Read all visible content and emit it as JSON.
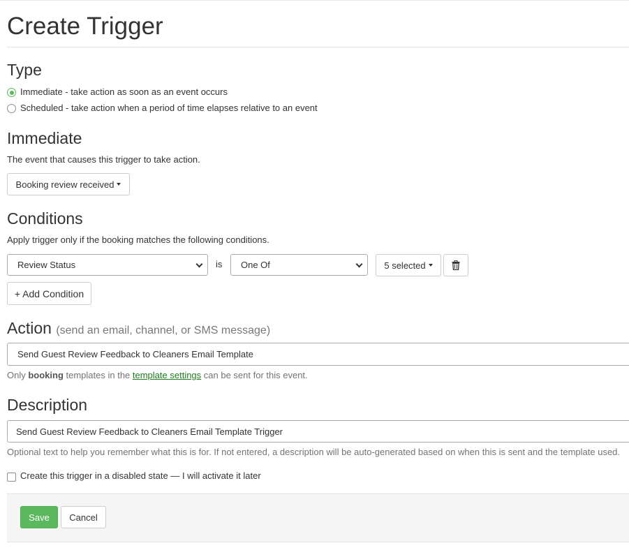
{
  "page": {
    "title": "Create Trigger"
  },
  "type_section": {
    "heading": "Type",
    "options": [
      {
        "label": "Immediate - take action as soon as an event occurs",
        "selected": true
      },
      {
        "label": "Scheduled - take action when a period of time elapses relative to an event",
        "selected": false
      }
    ]
  },
  "immediate_section": {
    "heading": "Immediate",
    "help": "The event that causes this trigger to take action.",
    "event_button": "Booking review received"
  },
  "conditions_section": {
    "heading": "Conditions",
    "help": "Apply trigger only if the booking matches the following conditions.",
    "row": {
      "field": "Review Status",
      "operator_label": "is",
      "operator": "One Of",
      "values_button": "5 selected"
    },
    "add_button": "+ Add Condition"
  },
  "action_section": {
    "heading": "Action",
    "subheading": "(send an email, channel, or SMS message)",
    "value": "Send Guest Review Feedback to Cleaners Email Template",
    "help_prefix": "Only ",
    "help_bold": "booking",
    "help_middle": " templates in the ",
    "help_link": "template settings",
    "help_suffix": " can be sent for this event."
  },
  "description_section": {
    "heading": "Description",
    "value": "Send Guest Review Feedback to Cleaners Email Template Trigger",
    "help": "Optional text to help you remember what this is for. If not entered, a description will be auto-generated based on when this is sent and the template used."
  },
  "disabled_checkbox": {
    "label": "Create this trigger in a disabled state — I will activate it later",
    "checked": false
  },
  "footer": {
    "save": "Save",
    "cancel": "Cancel"
  },
  "colors": {
    "primary": "#5cb85c",
    "link": "#1e7b1e",
    "text": "#333333",
    "muted": "#737373"
  },
  "icons": {
    "delete": "trash-icon"
  }
}
